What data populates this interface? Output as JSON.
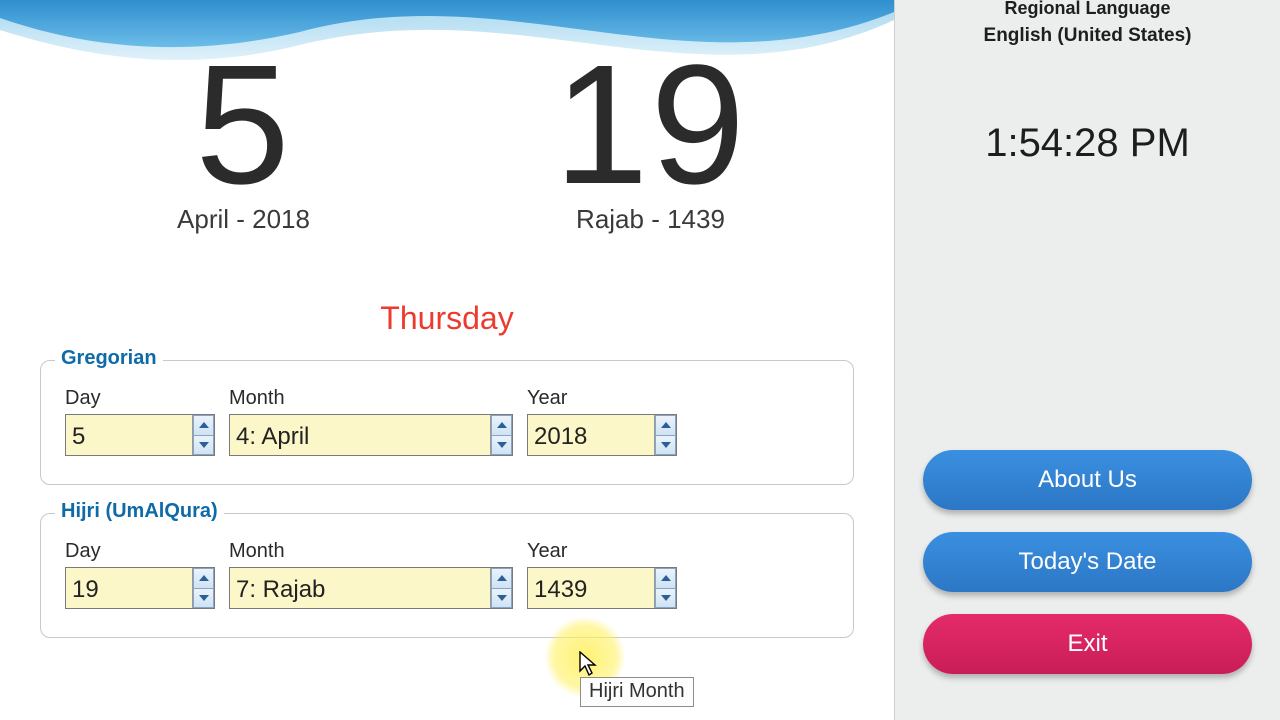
{
  "header": {
    "gregorian_day": "5",
    "gregorian_sub": "April - 2018",
    "hijri_day": "19",
    "hijri_sub": "Rajab - 1439",
    "weekday": "Thursday"
  },
  "groups": {
    "gregorian": {
      "legend": "Gregorian",
      "day_label": "Day",
      "month_label": "Month",
      "year_label": "Year",
      "day_value": "5",
      "month_value": "4: April",
      "year_value": "2018"
    },
    "hijri": {
      "legend": "Hijri (UmAlQura)",
      "day_label": "Day",
      "month_label": "Month",
      "year_label": "Year",
      "day_value": "19",
      "month_value": "7: Rajab",
      "year_value": "1439"
    }
  },
  "tooltip": "Hijri Month",
  "side": {
    "lang_title": "Regional Language",
    "lang_value": "English (United States)",
    "clock": "1:54:28 PM",
    "about": "About Us",
    "today": "Today's Date",
    "exit": "Exit"
  }
}
